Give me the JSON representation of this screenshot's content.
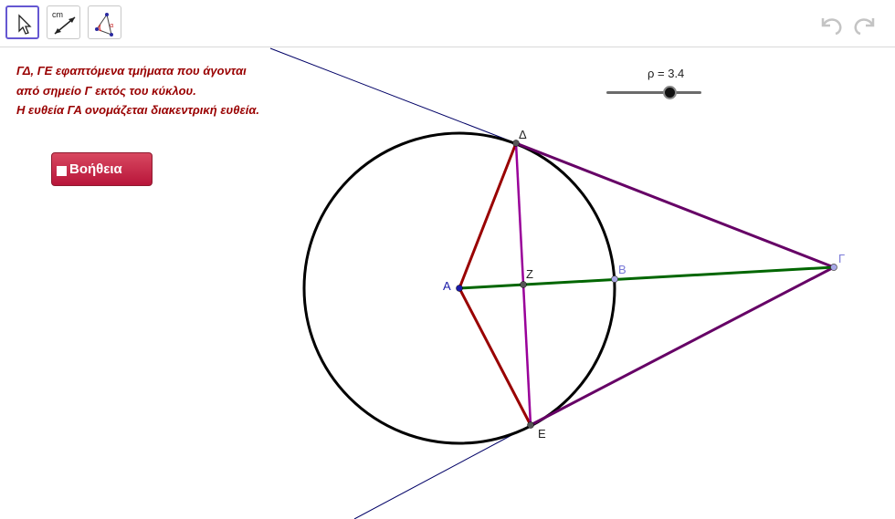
{
  "toolbar": {
    "tools": [
      {
        "name": "move-tool",
        "icon": "cursor-arrow-icon",
        "active": true
      },
      {
        "name": "measure-tool",
        "icon": "distance-measure-icon",
        "label": "cm"
      },
      {
        "name": "angle-tool",
        "icon": "angle-icon",
        "label": "α"
      }
    ],
    "undo_icon": "undo-icon",
    "redo_icon": "redo-icon"
  },
  "info_text": {
    "line1": "ΓΔ, ΓΕ εφαπτόμενα τμήματα που άγονται",
    "line2": "από σημείο Γ εκτός του κύκλου.",
    "line3": "Η ευθεία ΓΑ ονομάζεται διακεντρική ευθεία."
  },
  "help_button": {
    "label": "Βοήθεια"
  },
  "slider": {
    "label": "ρ = 3.4",
    "value": 3.4
  },
  "points": {
    "A": "A",
    "B": "B",
    "G": "Γ",
    "D": "Δ",
    "E": "Ε",
    "Z": "Z"
  },
  "colors": {
    "accent": "#6557d2",
    "info_text": "#990000",
    "radius_lines": "#990000",
    "tangent_lines": "#660066",
    "chord": "#990099",
    "center_line": "#006600",
    "tangent_rays": "#000066",
    "circle": "#000000"
  }
}
